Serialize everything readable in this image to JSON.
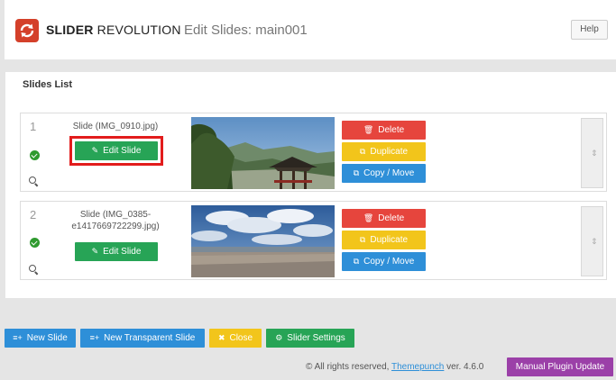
{
  "header": {
    "brand_bold": "SLIDER",
    "brand_rest": "REVOLUTION",
    "page_title": "Edit Slides: main001",
    "help_label": "Help"
  },
  "slides_list": {
    "title": "Slides List",
    "slides": [
      {
        "number": "1",
        "name_line1": "Slide (IMG_0910.jpg)",
        "name_line2": "",
        "edit_label": "Edit Slide",
        "delete_label": "Delete",
        "duplicate_label": "Duplicate",
        "copy_move_label": "Copy / Move",
        "drag_glyph": "⇕"
      },
      {
        "number": "2",
        "name_line1": "Slide (IMG_0385-",
        "name_line2": "e1417669722299.jpg)",
        "edit_label": "Edit Slide",
        "delete_label": "Delete",
        "duplicate_label": "Duplicate",
        "copy_move_label": "Copy / Move",
        "drag_glyph": "⇕"
      }
    ]
  },
  "bottom_bar": {
    "new_slide": "New Slide",
    "new_transparent_slide": "New Transparent Slide",
    "close": "Close",
    "slider_settings": "Slider Settings",
    "manual_update": "Manual Plugin Update"
  },
  "footer": {
    "prefix": "© All rights reserved, ",
    "link": "Themepunch",
    "suffix": " ver. 4.6.0"
  },
  "colors": {
    "logo": "#d4402a",
    "green": "#27a456",
    "red": "#e6453d",
    "yellow": "#f2c51b",
    "blue": "#2e8fd8",
    "purple": "#9b40a8",
    "highlight": "#e21c1c"
  }
}
